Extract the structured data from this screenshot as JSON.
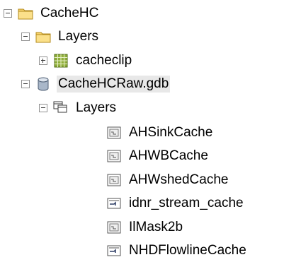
{
  "tree": {
    "root": {
      "label": "CacheHC",
      "icon": "folder-icon",
      "expanded": true,
      "children": [
        {
          "label": "Layers",
          "icon": "folder-icon",
          "expanded": true,
          "children": [
            {
              "label": "cacheclip",
              "icon": "raster-icon",
              "expanded": false
            }
          ]
        },
        {
          "label": "CacheHCRaw.gdb",
          "icon": "geodatabase-icon",
          "expanded": true,
          "selected": true,
          "children": [
            {
              "label": "Layers",
              "icon": "feature-dataset-icon",
              "expanded": true,
              "children": [
                {
                  "label": "AHSinkCache",
                  "icon": "raster-dataset-icon"
                },
                {
                  "label": "AHWBCache",
                  "icon": "raster-dataset-icon"
                },
                {
                  "label": "AHWshedCache",
                  "icon": "raster-dataset-icon"
                },
                {
                  "label": "idnr_stream_cache",
                  "icon": "line-feature-class-icon"
                },
                {
                  "label": "IlMask2b",
                  "icon": "raster-dataset-icon"
                },
                {
                  "label": "NHDFlowlineCache",
                  "icon": "line-feature-class-icon"
                }
              ]
            }
          ]
        }
      ]
    }
  },
  "colors": {
    "folder": "#f2c94c",
    "selection": "#e8e8e8",
    "toggle_border": "#919191"
  }
}
